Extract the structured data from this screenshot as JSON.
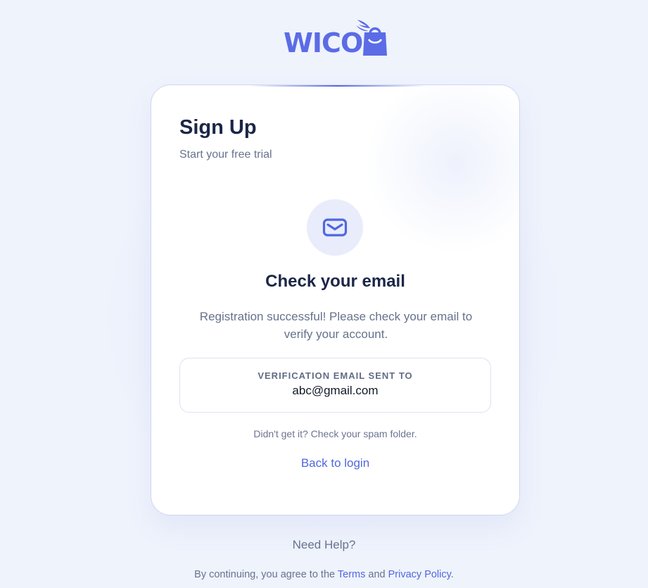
{
  "brand": {
    "name": "WICO",
    "logo_icon": "winged-shopping-bag-icon",
    "color": "#5b6ce6"
  },
  "card": {
    "title": "Sign Up",
    "subtitle": "Start your free trial",
    "status_icon": "mail-icon",
    "heading": "Check your email",
    "message": "Registration successful! Please check your email to verify your account.",
    "email_box": {
      "label": "VERIFICATION EMAIL SENT TO",
      "email": "abc@gmail.com"
    },
    "spam_hint": "Didn't get it? Check your spam folder.",
    "back_link": "Back to login"
  },
  "help": {
    "label": "Need Help?"
  },
  "footer": {
    "prefix": "By continuing, you agree to the",
    "terms": "Terms",
    "and": "and",
    "privacy": "Privacy Policy",
    "suffix": "."
  },
  "colors": {
    "accent": "#4f67df",
    "heading": "#1b2647",
    "muted": "#67738f",
    "background": "#eff3fc"
  }
}
